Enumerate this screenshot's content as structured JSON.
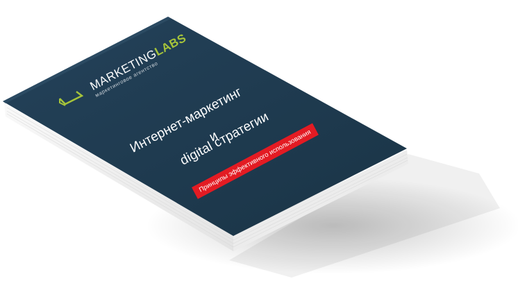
{
  "cover": {
    "brand": {
      "name_main": "MARKETING",
      "name_accent": "LABS",
      "tagline": "маркетинговое агентство"
    },
    "title_line1": "Интернет-маркетинг",
    "title_line2": "и",
    "title_line3": "digital стратегии",
    "badge": "Принципы эффективного использования"
  },
  "colors": {
    "cover": "#1e3a4c",
    "accent": "#a6c43a",
    "badge": "#e31b23",
    "pages": "#f4f4f4"
  }
}
